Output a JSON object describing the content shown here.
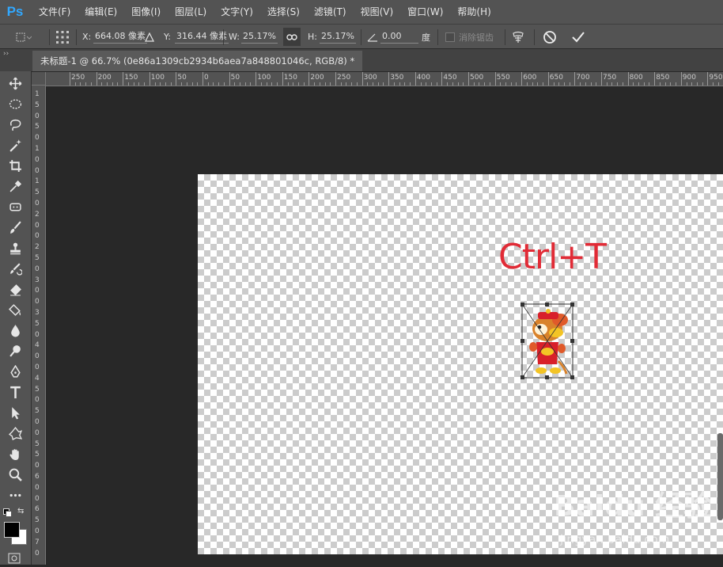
{
  "app": {
    "logo": "Ps"
  },
  "menu": [
    "文件(F)",
    "编辑(E)",
    "图像(I)",
    "图层(L)",
    "文字(Y)",
    "选择(S)",
    "滤镜(T)",
    "视图(V)",
    "窗口(W)",
    "帮助(H)"
  ],
  "options": {
    "x_label": "X:",
    "x_value": "664.08 像素",
    "y_label": "Y:",
    "y_value": "316.44 像素",
    "w_label": "W:",
    "w_value": "25.17%",
    "h_label": "H:",
    "h_value": "25.17%",
    "angle_value": "0.00",
    "angle_unit": "度",
    "antialias_label": "消除锯齿"
  },
  "document": {
    "tab_title": "未标题-1 @ 66.7% (0e86a1309cb2934b6aea7a848801046c, RGB/8) *"
  },
  "ruler": {
    "top_labels": [
      "250",
      "200",
      "150",
      "100",
      "50",
      "0",
      "50",
      "100",
      "150",
      "200",
      "250",
      "300",
      "350",
      "400",
      "450",
      "500",
      "550",
      "600",
      "650",
      "700",
      "750",
      "800",
      "850",
      "900",
      "950"
    ],
    "left_labels": [
      "1",
      "5",
      "0",
      "5",
      "0",
      "1",
      "0",
      "0",
      "1",
      "5",
      "0",
      "2",
      "0",
      "0",
      "2",
      "5",
      "0",
      "3",
      "0",
      "0",
      "3",
      "5",
      "0",
      "4",
      "0",
      "0",
      "4",
      "5",
      "0",
      "5",
      "0",
      "0",
      "5",
      "5",
      "0",
      "6",
      "0",
      "0",
      "6",
      "5",
      "0",
      "7",
      "0"
    ]
  },
  "canvas": {
    "overlay_text": "Ctrl+T"
  },
  "watermark": {
    "logo": "Baidu 经验",
    "url": "jingyan.baidu.com"
  },
  "colors": {
    "accent": "#31a8ff",
    "overlay": "#e12b36",
    "foreground": "#000000",
    "background": "#ffffff"
  },
  "tools": [
    "move-icon",
    "marquee-icon",
    "lasso-icon",
    "magic-wand-icon",
    "crop-icon",
    "eyedropper-icon",
    "healing-icon",
    "brush-icon",
    "clone-stamp-icon",
    "history-brush-icon",
    "eraser-icon",
    "paint-bucket-icon",
    "blur-icon",
    "dodge-icon",
    "pen-icon",
    "type-icon",
    "path-select-icon",
    "shape-icon",
    "hand-icon",
    "zoom-icon",
    "more-tools-icon"
  ]
}
